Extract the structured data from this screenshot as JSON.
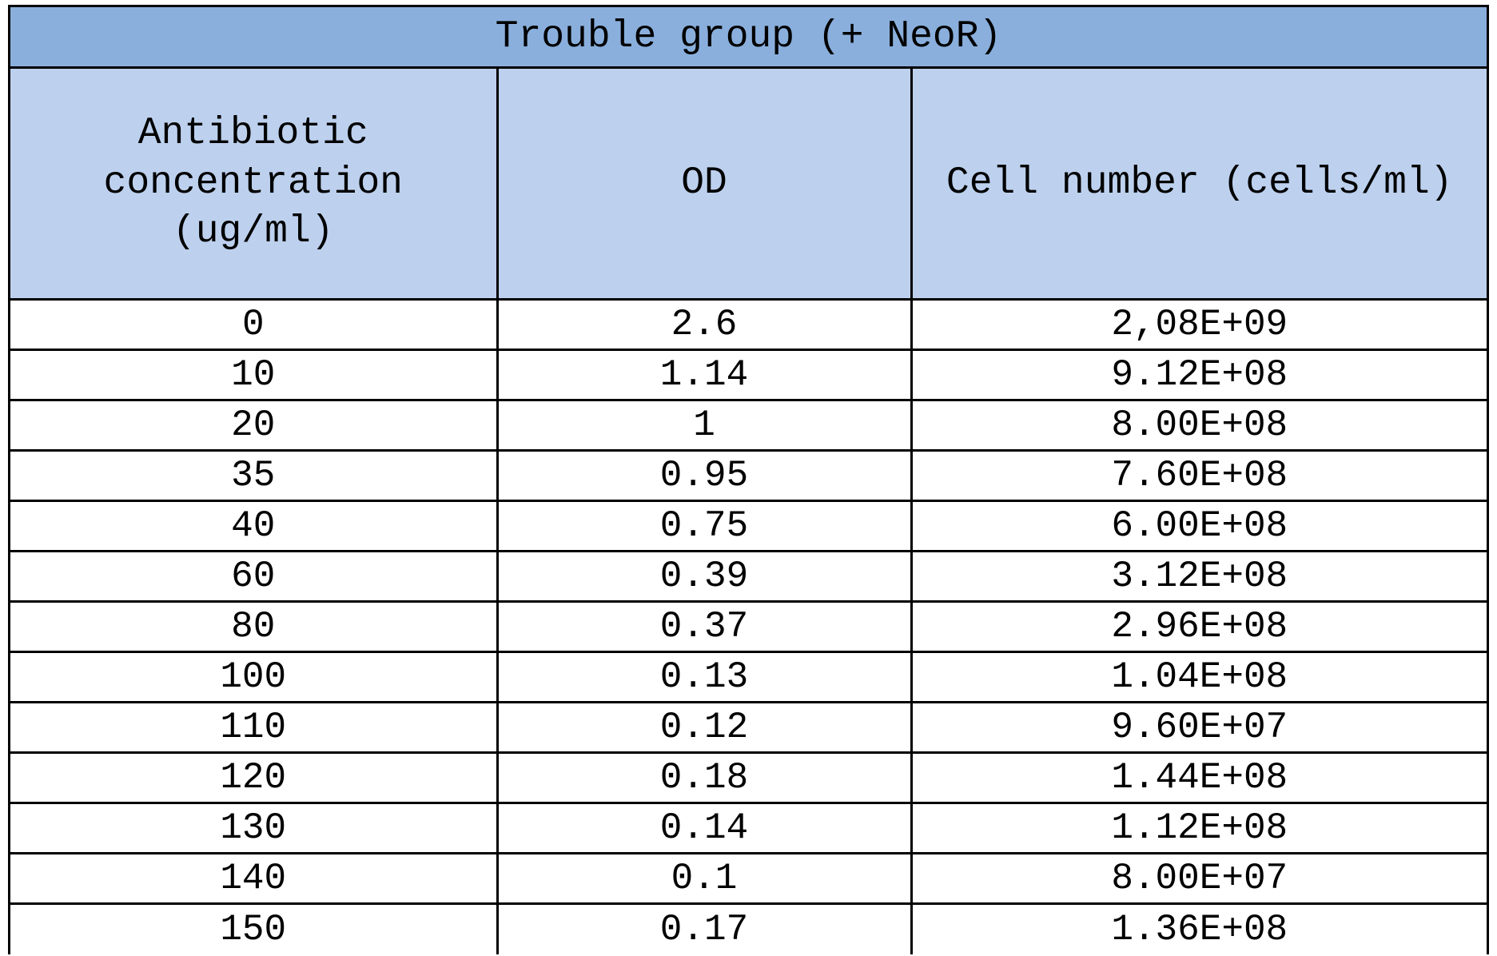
{
  "chart_data": {
    "type": "table",
    "title": "Trouble group (+ NeoR)",
    "columns": [
      "Antibiotic concentration (ug/ml)",
      "OD",
      "Cell number (cells/ml)"
    ],
    "rows": [
      {
        "conc": "0",
        "od": "2.6",
        "cells": "2,08E+09"
      },
      {
        "conc": "10",
        "od": "1.14",
        "cells": "9.12E+08"
      },
      {
        "conc": "20",
        "od": "1",
        "cells": "8.00E+08"
      },
      {
        "conc": "35",
        "od": "0.95",
        "cells": "7.60E+08"
      },
      {
        "conc": "40",
        "od": "0.75",
        "cells": "6.00E+08"
      },
      {
        "conc": "60",
        "od": "0.39",
        "cells": "3.12E+08"
      },
      {
        "conc": "80",
        "od": "0.37",
        "cells": "2.96E+08"
      },
      {
        "conc": "100",
        "od": "0.13",
        "cells": "1.04E+08"
      },
      {
        "conc": "110",
        "od": "0.12",
        "cells": "9.60E+07"
      },
      {
        "conc": "120",
        "od": "0.18",
        "cells": "1.44E+08"
      },
      {
        "conc": "130",
        "od": "0.14",
        "cells": "1.12E+08"
      },
      {
        "conc": "140",
        "od": "0.1",
        "cells": "8.00E+07"
      },
      {
        "conc": "150",
        "od": "0.17",
        "cells": "1.36E+08"
      }
    ]
  }
}
